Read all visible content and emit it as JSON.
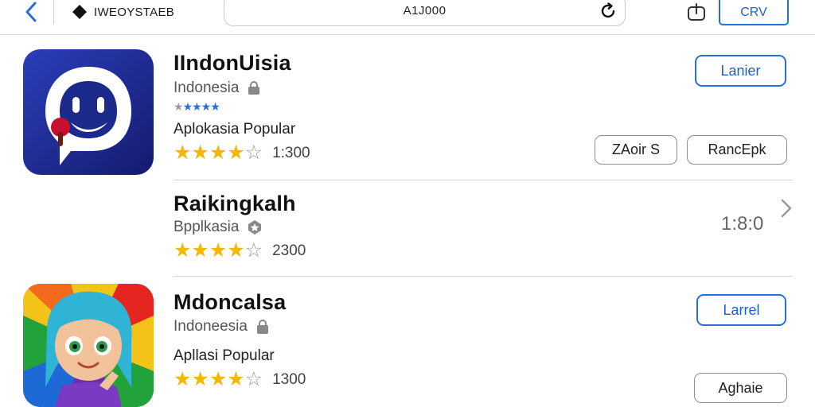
{
  "topbar": {
    "brand": "IWEOYSTAEB",
    "url": "A1J000",
    "action_button": "CRV"
  },
  "apps": [
    {
      "name": "IIndonUisia",
      "subtitle": "Indonesia",
      "category": "Aplokasia Popular",
      "rating_stars": 3.5,
      "rating_count": "1:300",
      "primary_button": "Lanier",
      "secondary_buttons": [
        "ZAoir S",
        "RancEpk"
      ]
    },
    {
      "name": "Raikingkalh",
      "subtitle": "Bpplkasia",
      "category": "",
      "rating_stars": 3.5,
      "rating_count": "2300",
      "side_value": "1:8:0"
    },
    {
      "name": "Mdoncalsa",
      "subtitle": "Indoneesia",
      "category": "Apllasi Popular",
      "rating_stars": 4.5,
      "rating_count": "1300",
      "primary_button": "Larrel",
      "secondary_buttons": [
        "Aghaie"
      ]
    }
  ],
  "colors": {
    "accent": "#2a6fd6",
    "star": "#f5b800",
    "icon1_bg": "#1c2a8c"
  }
}
